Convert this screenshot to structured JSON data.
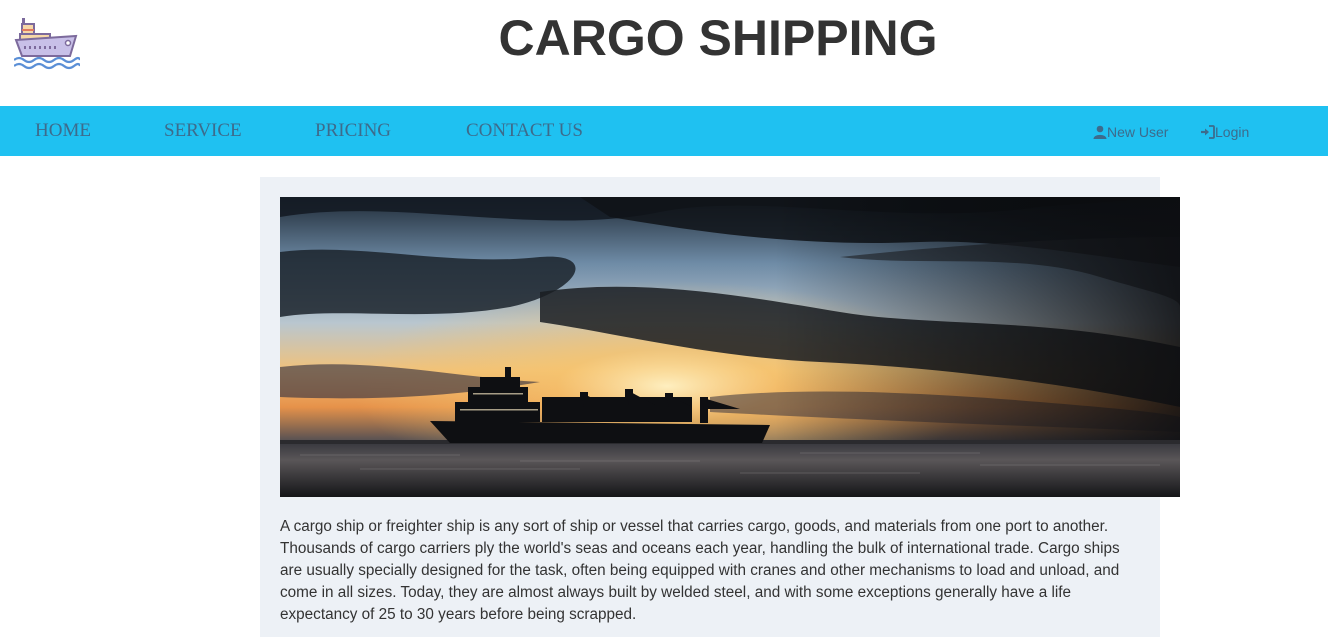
{
  "header": {
    "logo_icon": "cargo-ship-icon",
    "title": "CARGO SHIPPING"
  },
  "nav": {
    "background": "#1fc1f1",
    "link_color": "#3d6b8c",
    "items": [
      {
        "label": "HOME"
      },
      {
        "label": "SERVICE"
      },
      {
        "label": "PRICING"
      },
      {
        "label": "CONTACT US"
      }
    ],
    "new_user": {
      "label": "New User",
      "icon": "user-icon"
    },
    "login": {
      "label": "Login",
      "icon": "login-icon"
    }
  },
  "main": {
    "panel_background": "#edf1f6",
    "hero_image": "cargo-ship-at-sunset",
    "description": "A cargo ship or freighter ship is any sort of ship or vessel that carries cargo, goods, and materials from one port to another. Thousands of cargo carriers ply the world's seas and oceans each year, handling the bulk of international trade. Cargo ships are usually specially designed for the task, often being equipped with cranes and other mechanisms to load and unload, and come in all sizes. Today, they are almost always built by welded steel, and with some exceptions generally have a life expectancy of 25 to 30 years before being scrapped."
  }
}
